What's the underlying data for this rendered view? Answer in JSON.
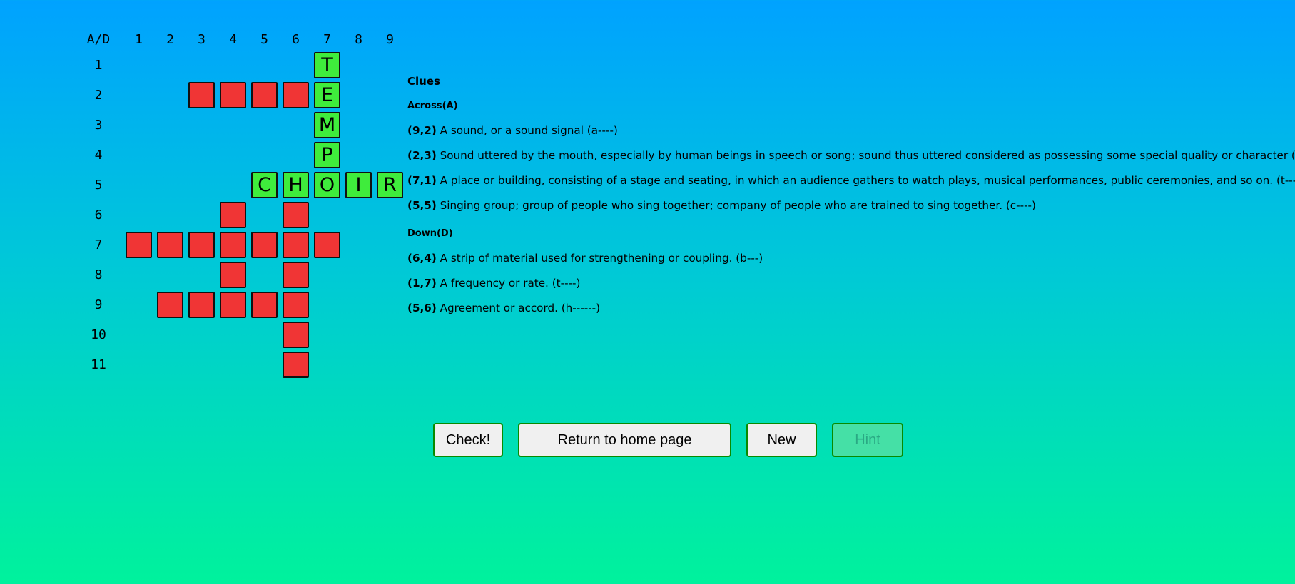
{
  "grid": {
    "corner_label": "A/D",
    "column_labels": [
      "1",
      "2",
      "3",
      "4",
      "5",
      "6",
      "7",
      "8",
      "9"
    ],
    "row_labels": [
      "1",
      "2",
      "3",
      "4",
      "5",
      "6",
      "7",
      "8",
      "9",
      "10",
      "11"
    ],
    "cells": [
      {
        "col": 7,
        "row": 1,
        "state": "correct",
        "letter": "T"
      },
      {
        "col": 3,
        "row": 2,
        "state": "empty",
        "letter": ""
      },
      {
        "col": 4,
        "row": 2,
        "state": "empty",
        "letter": ""
      },
      {
        "col": 5,
        "row": 2,
        "state": "empty",
        "letter": ""
      },
      {
        "col": 6,
        "row": 2,
        "state": "empty",
        "letter": ""
      },
      {
        "col": 7,
        "row": 2,
        "state": "correct",
        "letter": "E"
      },
      {
        "col": 7,
        "row": 3,
        "state": "correct",
        "letter": "M"
      },
      {
        "col": 7,
        "row": 4,
        "state": "correct",
        "letter": "P"
      },
      {
        "col": 5,
        "row": 5,
        "state": "correct",
        "letter": "C"
      },
      {
        "col": 6,
        "row": 5,
        "state": "correct",
        "letter": "H"
      },
      {
        "col": 7,
        "row": 5,
        "state": "correct",
        "letter": "O"
      },
      {
        "col": 8,
        "row": 5,
        "state": "correct",
        "letter": "I"
      },
      {
        "col": 9,
        "row": 5,
        "state": "correct",
        "letter": "R"
      },
      {
        "col": 4,
        "row": 6,
        "state": "empty",
        "letter": ""
      },
      {
        "col": 6,
        "row": 6,
        "state": "empty",
        "letter": ""
      },
      {
        "col": 1,
        "row": 7,
        "state": "empty",
        "letter": ""
      },
      {
        "col": 2,
        "row": 7,
        "state": "empty",
        "letter": ""
      },
      {
        "col": 3,
        "row": 7,
        "state": "empty",
        "letter": ""
      },
      {
        "col": 4,
        "row": 7,
        "state": "empty",
        "letter": ""
      },
      {
        "col": 5,
        "row": 7,
        "state": "empty",
        "letter": ""
      },
      {
        "col": 6,
        "row": 7,
        "state": "empty",
        "letter": ""
      },
      {
        "col": 7,
        "row": 7,
        "state": "empty",
        "letter": ""
      },
      {
        "col": 4,
        "row": 8,
        "state": "empty",
        "letter": ""
      },
      {
        "col": 6,
        "row": 8,
        "state": "empty",
        "letter": ""
      },
      {
        "col": 2,
        "row": 9,
        "state": "empty",
        "letter": ""
      },
      {
        "col": 3,
        "row": 9,
        "state": "empty",
        "letter": ""
      },
      {
        "col": 4,
        "row": 9,
        "state": "empty",
        "letter": ""
      },
      {
        "col": 5,
        "row": 9,
        "state": "empty",
        "letter": ""
      },
      {
        "col": 6,
        "row": 9,
        "state": "empty",
        "letter": ""
      },
      {
        "col": 6,
        "row": 10,
        "state": "empty",
        "letter": ""
      },
      {
        "col": 6,
        "row": 11,
        "state": "empty",
        "letter": ""
      }
    ]
  },
  "colors": {
    "empty_cell": "#f03535",
    "correct_cell": "#3fec3c",
    "button_border": "#0a8a00"
  },
  "clues": {
    "title": "Clues",
    "across_title": "Across(A)",
    "across": [
      {
        "pos": "(9,2)",
        "text": "A sound, or a sound signal (a----)"
      },
      {
        "pos": "(2,3)",
        "text": "Sound uttered by the mouth, especially by human beings in speech or song; sound thus uttered considered as possessing some special quality or character (v----)"
      },
      {
        "pos": "(7,1)",
        "text": "A place or building, consisting of a stage and seating, in which an audience gathers to watch plays, musical performances, public ceremonies, and so on. (t------)"
      },
      {
        "pos": "(5,5)",
        "text": "Singing group; group of people who sing together; company of people who are trained to sing together. (c----)"
      }
    ],
    "down_title": "Down(D)",
    "down": [
      {
        "pos": "(6,4)",
        "text": "A strip of material used for strengthening or coupling. (b---)"
      },
      {
        "pos": "(1,7)",
        "text": "A frequency or rate. (t----)"
      },
      {
        "pos": "(5,6)",
        "text": "Agreement or accord. (h------)"
      }
    ]
  },
  "buttons": {
    "check": "Check!",
    "home": "Return to home page",
    "new": "New",
    "hint": "Hint"
  }
}
